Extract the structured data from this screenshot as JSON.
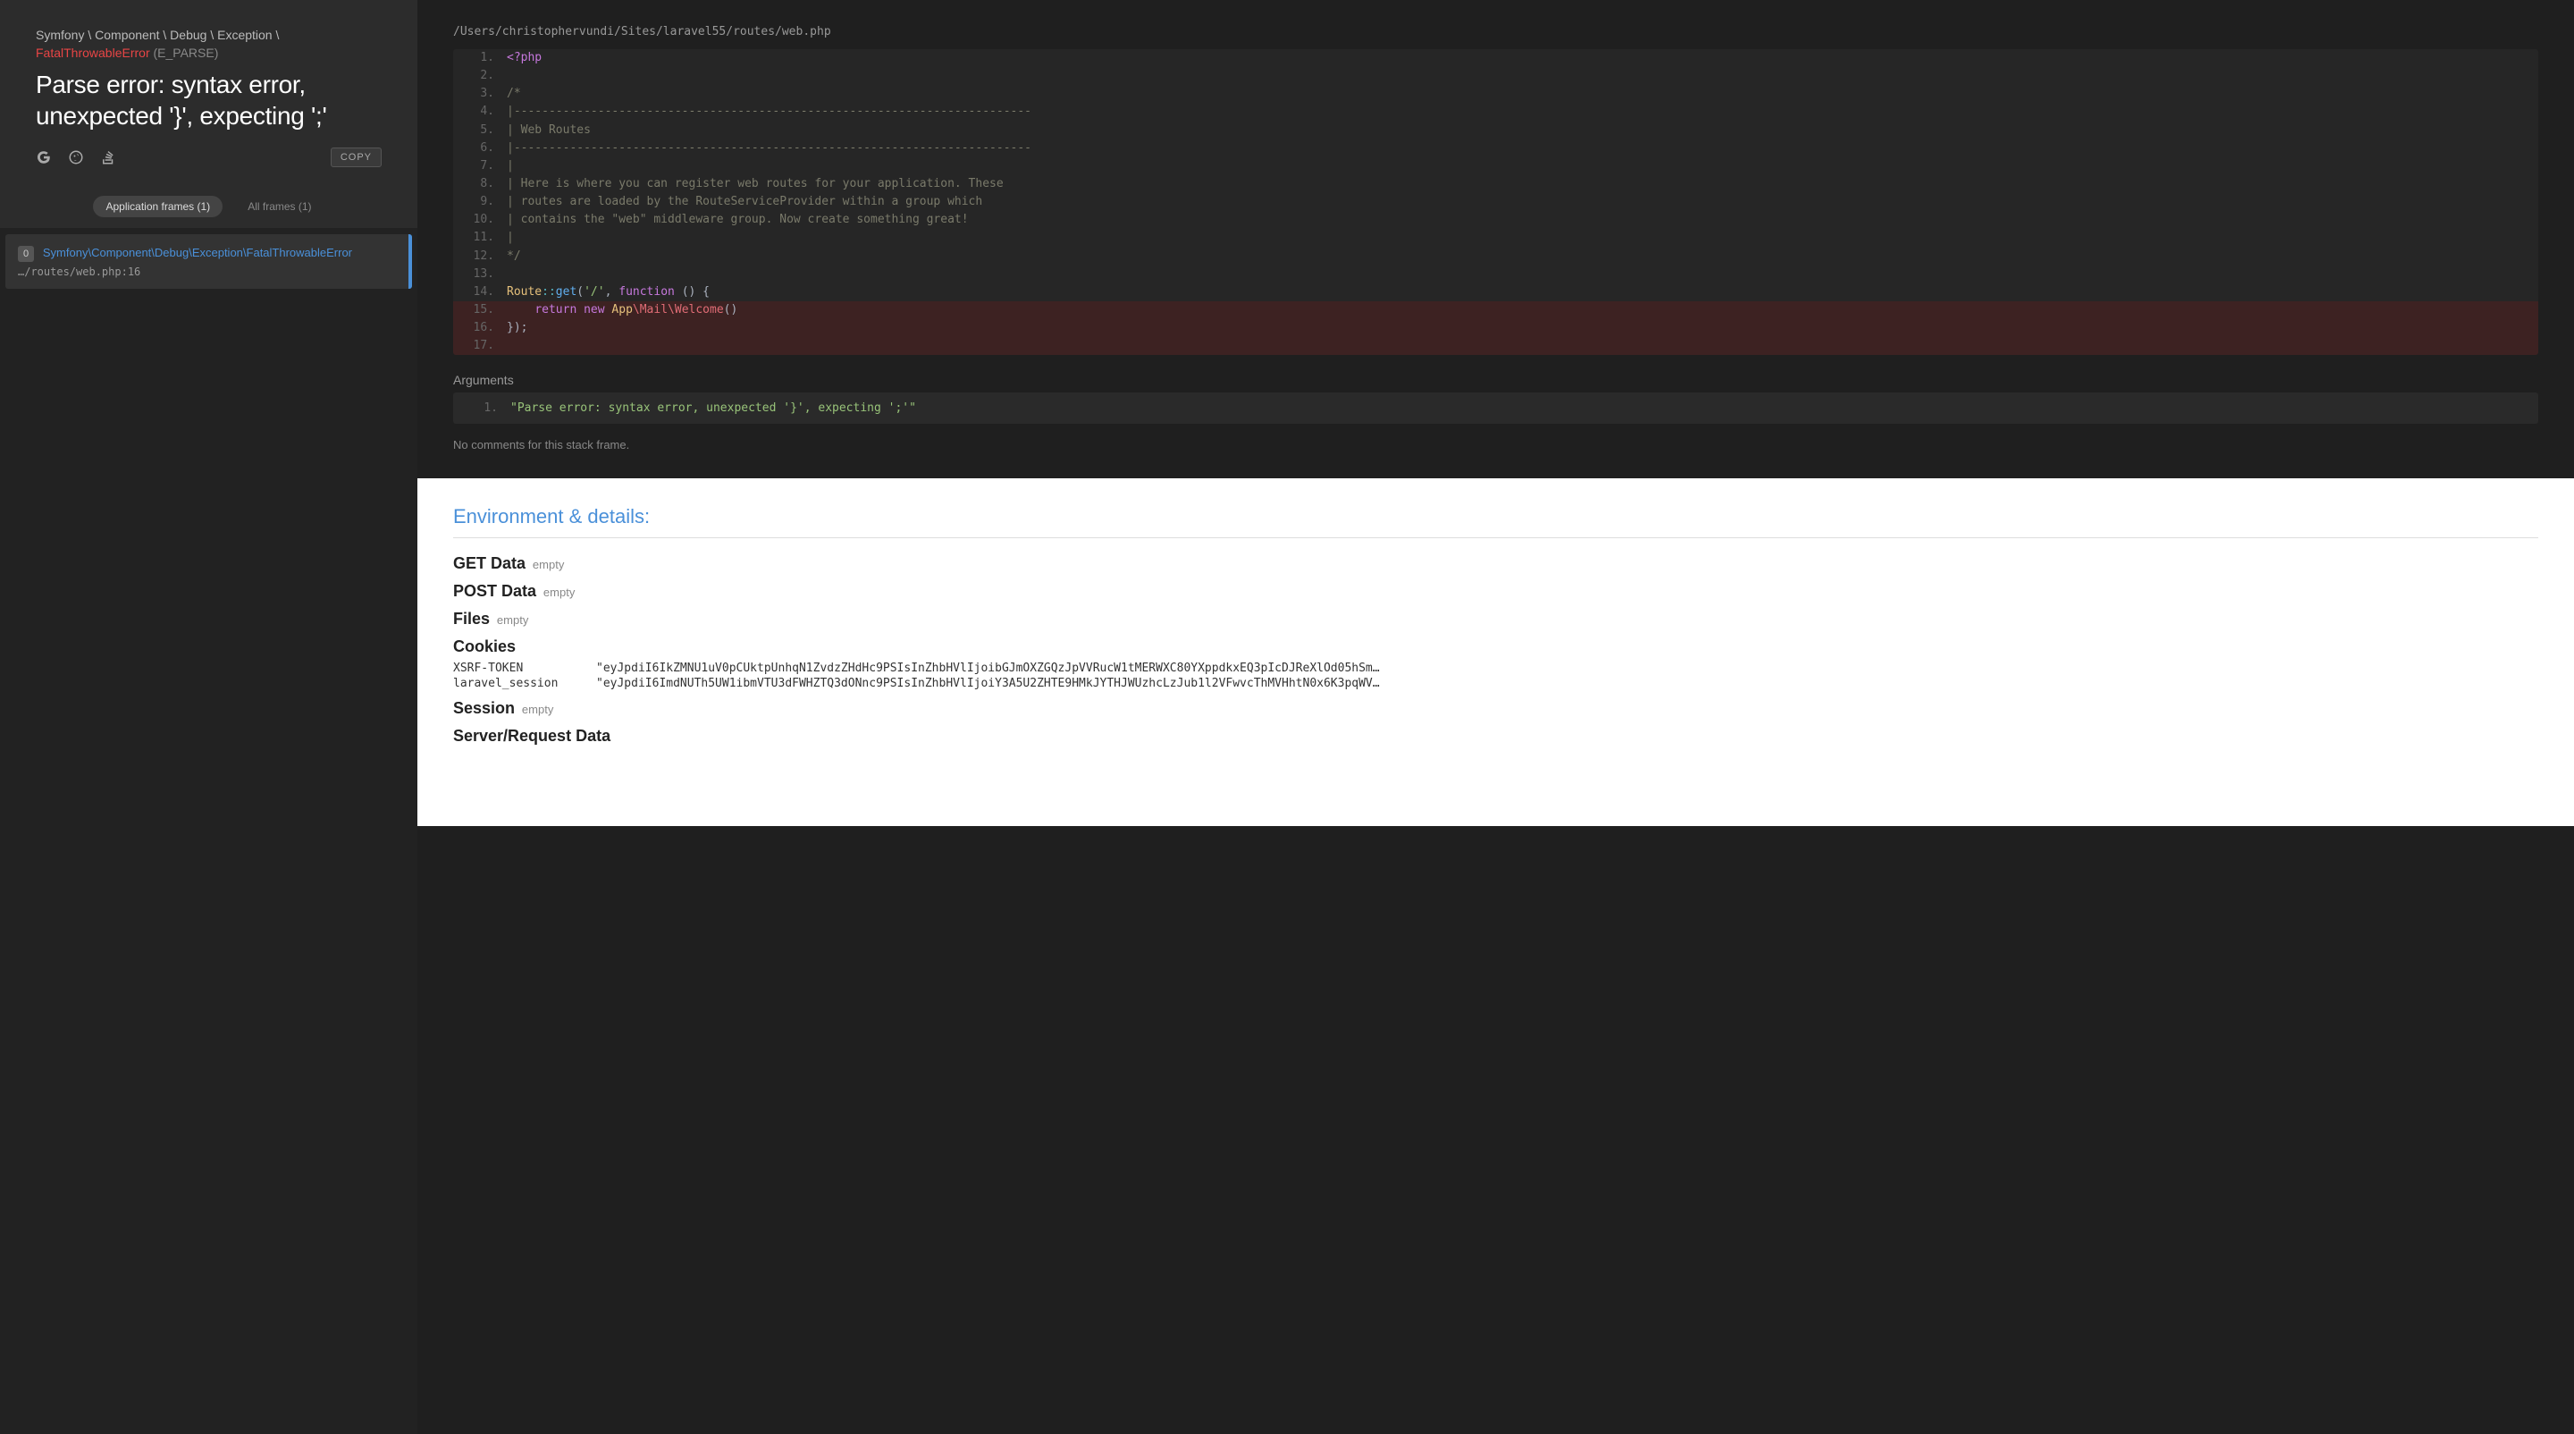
{
  "breadcrumb": {
    "parts": [
      "Symfony",
      "Component",
      "Debug",
      "Exception"
    ],
    "fatal": "FatalThrowableError",
    "code": "(E_PARSE)"
  },
  "exception_message": "Parse error: syntax error, unexpected '}', expecting ';'",
  "copy_label": "COPY",
  "tabs": {
    "app": "Application frames (1)",
    "all": "All frames (1)"
  },
  "frame": {
    "num": "0",
    "class": "Symfony\\Component\\Debug\\Exception\\FatalThrowableError",
    "path": "…/routes/web.php:16"
  },
  "file_path": "/Users/christophervundi/Sites/laravel55/routes/web.php",
  "code_lines": [
    {
      "n": "1.",
      "hl": false,
      "segs": [
        {
          "t": "<?php",
          "c": "c-keyword"
        }
      ]
    },
    {
      "n": "2.",
      "hl": false,
      "segs": []
    },
    {
      "n": "3.",
      "hl": false,
      "segs": [
        {
          "t": "/*",
          "c": "c-comment"
        }
      ]
    },
    {
      "n": "4.",
      "hl": false,
      "segs": [
        {
          "t": "|--------------------------------------------------------------------------",
          "c": "c-comment"
        }
      ]
    },
    {
      "n": "5.",
      "hl": false,
      "segs": [
        {
          "t": "| Web Routes",
          "c": "c-comment"
        }
      ]
    },
    {
      "n": "6.",
      "hl": false,
      "segs": [
        {
          "t": "|--------------------------------------------------------------------------",
          "c": "c-comment"
        }
      ]
    },
    {
      "n": "7.",
      "hl": false,
      "segs": [
        {
          "t": "|",
          "c": "c-comment"
        }
      ]
    },
    {
      "n": "8.",
      "hl": false,
      "segs": [
        {
          "t": "| Here is where you can register web routes for your application. These",
          "c": "c-comment"
        }
      ]
    },
    {
      "n": "9.",
      "hl": false,
      "segs": [
        {
          "t": "| routes are loaded by the RouteServiceProvider within a group which",
          "c": "c-comment"
        }
      ]
    },
    {
      "n": "10.",
      "hl": false,
      "segs": [
        {
          "t": "| contains the \"web\" middleware group. Now create something great!",
          "c": "c-comment"
        }
      ]
    },
    {
      "n": "11.",
      "hl": false,
      "segs": [
        {
          "t": "|",
          "c": "c-comment"
        }
      ]
    },
    {
      "n": "12.",
      "hl": false,
      "segs": [
        {
          "t": "*/",
          "c": "c-comment"
        }
      ]
    },
    {
      "n": "13.",
      "hl": false,
      "segs": []
    },
    {
      "n": "14.",
      "hl": false,
      "segs": [
        {
          "t": "Route",
          "c": "c-class"
        },
        {
          "t": "::",
          "c": "c-static"
        },
        {
          "t": "get",
          "c": "c-func"
        },
        {
          "t": "(",
          "c": "c-punc"
        },
        {
          "t": "'/'",
          "c": "c-str"
        },
        {
          "t": ", ",
          "c": "c-punc"
        },
        {
          "t": "function",
          "c": "c-keyword"
        },
        {
          "t": " () {",
          "c": "c-punc"
        }
      ]
    },
    {
      "n": "15.",
      "hl": true,
      "segs": [
        {
          "t": "    ",
          "c": ""
        },
        {
          "t": "return",
          "c": "c-keyword"
        },
        {
          "t": " ",
          "c": ""
        },
        {
          "t": "new",
          "c": "c-keyword"
        },
        {
          "t": " ",
          "c": ""
        },
        {
          "t": "App",
          "c": "c-class"
        },
        {
          "t": "\\Mail\\Welcome",
          "c": "c-ns"
        },
        {
          "t": "()",
          "c": "c-punc"
        }
      ]
    },
    {
      "n": "16.",
      "hl": true,
      "segs": [
        {
          "t": "});",
          "c": "c-punc"
        }
      ]
    },
    {
      "n": "17.",
      "hl": true,
      "segs": []
    }
  ],
  "arguments": {
    "title": "Arguments",
    "items": [
      {
        "n": "1.",
        "val": "\"Parse error: syntax error, unexpected '}', expecting ';'\""
      }
    ]
  },
  "no_comments": "No comments for this stack frame.",
  "env": {
    "title": "Environment & details:",
    "rows": [
      {
        "key": "GET Data",
        "empty": "empty"
      },
      {
        "key": "POST Data",
        "empty": "empty"
      },
      {
        "key": "Files",
        "empty": "empty"
      }
    ],
    "cookies_label": "Cookies",
    "cookies": [
      {
        "name": "XSRF-TOKEN",
        "val": "\"eyJpdiI6IkZMNU1uV0pCUktpUnhqN1ZvdzZHdHc9PSIsInZhbHVlIjoibGJmOXZGQzJpVVRucW1tMERWXC80YXppdkxEQ3pIcDJReXlOd05hSm…"
      },
      {
        "name": "laravel_session",
        "val": "\"eyJpdiI6ImdNUTh5UW1ibmVTU3dFWHZTQ3dONnc9PSIsInZhbHVlIjoiY3A5U2ZHTE9HMkJYTHJWUzhcLzJub1l2VFwvcThMVHhtN0x6K3pqWV…"
      }
    ],
    "session_label": "Session",
    "session_empty": "empty",
    "server_label": "Server/Request Data"
  }
}
